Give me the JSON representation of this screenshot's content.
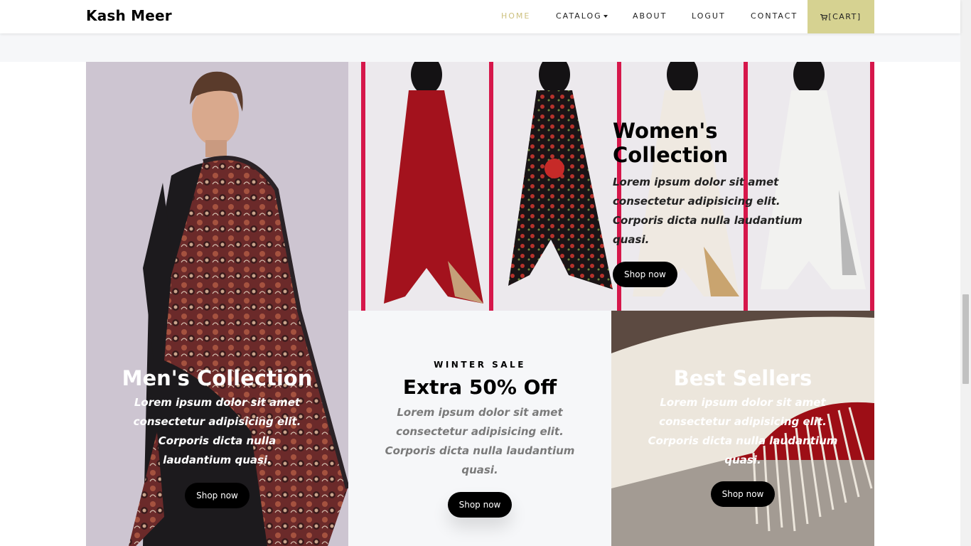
{
  "brand": "Kash Meer",
  "nav": {
    "home": "HOME",
    "catalog": "CATALOG",
    "about": "ABOUT",
    "logout": "LOGUT",
    "contact": "CONTACT",
    "cart": "[CART]",
    "active_color": "#cdc17f",
    "cart_bg": "#d6d291"
  },
  "tiles": {
    "men": {
      "title": "Men's Collection",
      "text": "Lorem ipsum dolor sit amet consectetur adipisicing elit. Corporis dicta nulla laudantium quasi.",
      "button": "Shop now"
    },
    "women": {
      "title": "Women's Collection",
      "text": "Lorem ipsum dolor sit amet consectetur adipisicing elit. Corporis dicta nulla laudantium quasi.",
      "button": "Shop now"
    },
    "sale": {
      "kicker": "WINTER SALE",
      "title": "Extra 50% Off",
      "text": "Lorem ipsum dolor sit amet consectetur adipisicing elit. Corporis dicta nulla laudantium quasi.",
      "button": "Shop now"
    },
    "best": {
      "title": "Best Sellers",
      "text": "Lorem ipsum dolor sit amet consectetur adipisicing elit. Corporis dicta nulla laudantium quasi.",
      "button": "Shop now"
    }
  },
  "icons": {
    "cart": "cart-icon",
    "catalog_dropdown": "caret-down-icon"
  }
}
